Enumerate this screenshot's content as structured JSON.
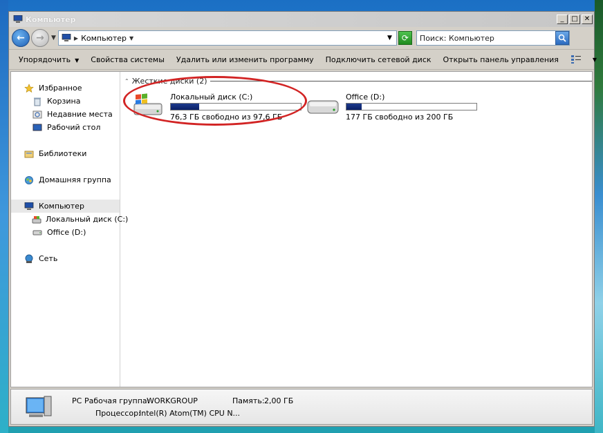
{
  "window": {
    "title": "Компьютер"
  },
  "address": {
    "path": "Компьютер",
    "search_placeholder": "Поиск: Компьютер"
  },
  "toolbar": {
    "organize": "Упорядочить",
    "system_properties": "Свойства системы",
    "uninstall": "Удалить или изменить программу",
    "map_drive": "Подключить сетевой диск",
    "control_panel": "Открыть панель управления"
  },
  "nav": {
    "favorites": "Избранное",
    "recycle": "Корзина",
    "recent": "Недавние места",
    "desktop": "Рабочий стол",
    "libraries": "Библиотеки",
    "homegroup": "Домашняя группа",
    "computer": "Компьютер",
    "drive_c": "Локальный диск (C:)",
    "drive_d": "Office (D:)",
    "network": "Сеть"
  },
  "group": {
    "header": "Жесткие диски (2)"
  },
  "drives": [
    {
      "name": "Локальный диск (C:)",
      "free_text": "76,3 ГБ свободно из 97,6 ГБ",
      "used_fraction": 0.22
    },
    {
      "name": "Office (D:)",
      "free_text": "177 ГБ свободно из 200 ГБ",
      "used_fraction": 0.115
    }
  ],
  "details": {
    "pc_name": "PC",
    "workgroup_label": "Рабочая группа:",
    "workgroup_value": "WORKGROUP",
    "memory_label": "Память:",
    "memory_value": "2,00 ГБ",
    "cpu_label": "Процессор:",
    "cpu_value": "Intel(R) Atom(TM) CPU N..."
  },
  "colors": {
    "highlight": "#d22424",
    "drive_fill": "#0a2066"
  }
}
